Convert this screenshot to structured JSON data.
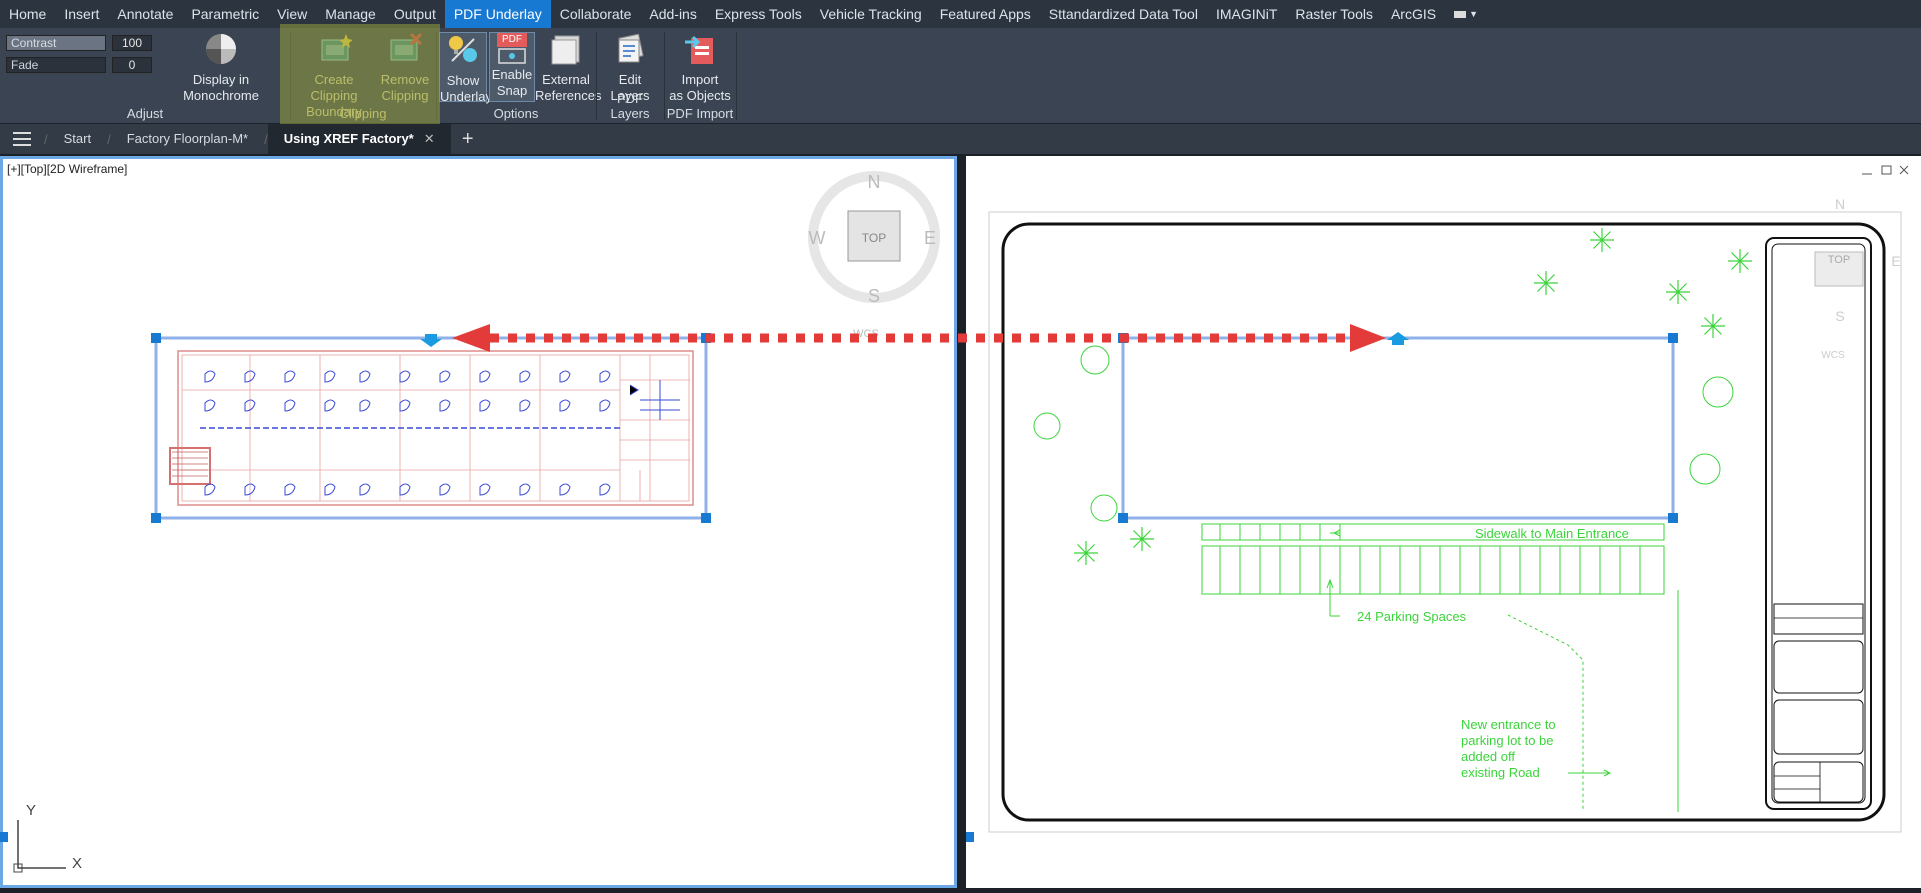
{
  "menu": {
    "tabs": [
      "Home",
      "Insert",
      "Annotate",
      "Parametric",
      "View",
      "Manage",
      "Output",
      "PDF Underlay",
      "Collaborate",
      "Add-ins",
      "Express Tools",
      "Vehicle Tracking",
      "Featured Apps",
      "Sttandardized Data Tool",
      "IMAGINiT",
      "Raster Tools",
      "ArcGIS"
    ],
    "active": "PDF Underlay"
  },
  "ribbon": {
    "adjust": {
      "title": "Adjust",
      "contrast_label": "Contrast",
      "contrast_value": "100",
      "fade_label": "Fade",
      "fade_value": "0",
      "monochrome_label": "Display in Monochrome"
    },
    "clipping": {
      "title": "Clipping",
      "create_line1": "Create Clipping",
      "create_line2": "Boundary",
      "remove_line1": "Remove",
      "remove_line2": "Clipping"
    },
    "options": {
      "title": "Options",
      "show_line1": "Show",
      "show_line2": "Underlay",
      "snap_line1": "Enable",
      "snap_line2": "Snap",
      "snap_badge": "PDF",
      "xref_line1": "External",
      "xref_line2": "References"
    },
    "layers": {
      "title": "PDF Layers",
      "edit_line1": "Edit",
      "edit_line2": "Layers"
    },
    "import": {
      "title": "PDF Import",
      "import_line1": "Import",
      "import_line2": "as Objects"
    }
  },
  "doc_tabs": {
    "start": "Start",
    "tab1": "Factory Floorplan-M*",
    "tab2": "Using XREF Factory*"
  },
  "viewport": {
    "label": "[+][Top][2D Wireframe]",
    "viewcube": {
      "n": "N",
      "s": "S",
      "e": "E",
      "w": "W",
      "top": "TOP",
      "wcs": "WCS"
    },
    "ucs": {
      "x": "X",
      "y": "Y"
    }
  },
  "site_plan": {
    "sidewalk": "Sidewalk to Main Entrance",
    "parking": "24 Parking Spaces",
    "entrance_lines": [
      "New entrance to",
      "parking lot to be",
      "added off",
      "existing Road"
    ]
  },
  "colors": {
    "accent": "#1779d1",
    "clip_highlight": "#969c3c",
    "arrow": "#e33a3a",
    "green": "#3bd43b"
  }
}
